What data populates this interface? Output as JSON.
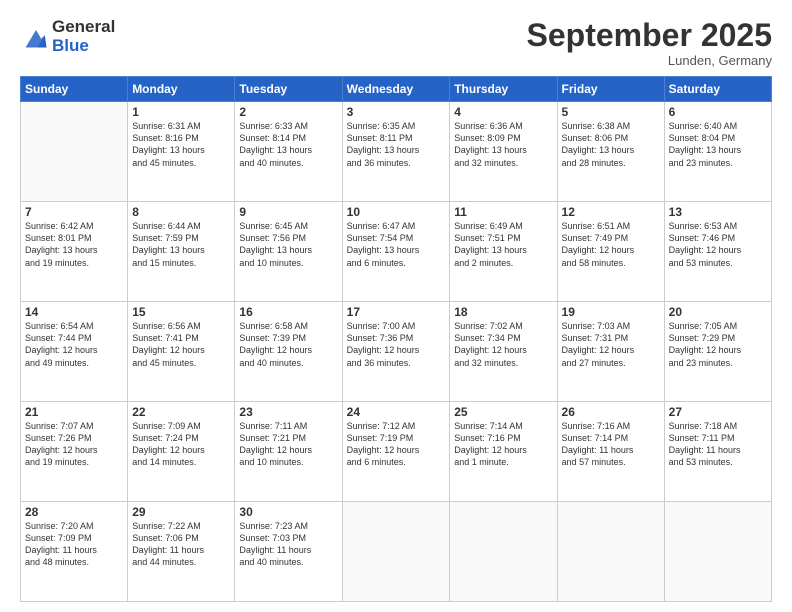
{
  "logo": {
    "general": "General",
    "blue": "Blue"
  },
  "title": "September 2025",
  "subtitle": "Lunden, Germany",
  "days_of_week": [
    "Sunday",
    "Monday",
    "Tuesday",
    "Wednesday",
    "Thursday",
    "Friday",
    "Saturday"
  ],
  "weeks": [
    [
      {
        "day": "",
        "info": ""
      },
      {
        "day": "1",
        "info": "Sunrise: 6:31 AM\nSunset: 8:16 PM\nDaylight: 13 hours\nand 45 minutes."
      },
      {
        "day": "2",
        "info": "Sunrise: 6:33 AM\nSunset: 8:14 PM\nDaylight: 13 hours\nand 40 minutes."
      },
      {
        "day": "3",
        "info": "Sunrise: 6:35 AM\nSunset: 8:11 PM\nDaylight: 13 hours\nand 36 minutes."
      },
      {
        "day": "4",
        "info": "Sunrise: 6:36 AM\nSunset: 8:09 PM\nDaylight: 13 hours\nand 32 minutes."
      },
      {
        "day": "5",
        "info": "Sunrise: 6:38 AM\nSunset: 8:06 PM\nDaylight: 13 hours\nand 28 minutes."
      },
      {
        "day": "6",
        "info": "Sunrise: 6:40 AM\nSunset: 8:04 PM\nDaylight: 13 hours\nand 23 minutes."
      }
    ],
    [
      {
        "day": "7",
        "info": "Sunrise: 6:42 AM\nSunset: 8:01 PM\nDaylight: 13 hours\nand 19 minutes."
      },
      {
        "day": "8",
        "info": "Sunrise: 6:44 AM\nSunset: 7:59 PM\nDaylight: 13 hours\nand 15 minutes."
      },
      {
        "day": "9",
        "info": "Sunrise: 6:45 AM\nSunset: 7:56 PM\nDaylight: 13 hours\nand 10 minutes."
      },
      {
        "day": "10",
        "info": "Sunrise: 6:47 AM\nSunset: 7:54 PM\nDaylight: 13 hours\nand 6 minutes."
      },
      {
        "day": "11",
        "info": "Sunrise: 6:49 AM\nSunset: 7:51 PM\nDaylight: 13 hours\nand 2 minutes."
      },
      {
        "day": "12",
        "info": "Sunrise: 6:51 AM\nSunset: 7:49 PM\nDaylight: 12 hours\nand 58 minutes."
      },
      {
        "day": "13",
        "info": "Sunrise: 6:53 AM\nSunset: 7:46 PM\nDaylight: 12 hours\nand 53 minutes."
      }
    ],
    [
      {
        "day": "14",
        "info": "Sunrise: 6:54 AM\nSunset: 7:44 PM\nDaylight: 12 hours\nand 49 minutes."
      },
      {
        "day": "15",
        "info": "Sunrise: 6:56 AM\nSunset: 7:41 PM\nDaylight: 12 hours\nand 45 minutes."
      },
      {
        "day": "16",
        "info": "Sunrise: 6:58 AM\nSunset: 7:39 PM\nDaylight: 12 hours\nand 40 minutes."
      },
      {
        "day": "17",
        "info": "Sunrise: 7:00 AM\nSunset: 7:36 PM\nDaylight: 12 hours\nand 36 minutes."
      },
      {
        "day": "18",
        "info": "Sunrise: 7:02 AM\nSunset: 7:34 PM\nDaylight: 12 hours\nand 32 minutes."
      },
      {
        "day": "19",
        "info": "Sunrise: 7:03 AM\nSunset: 7:31 PM\nDaylight: 12 hours\nand 27 minutes."
      },
      {
        "day": "20",
        "info": "Sunrise: 7:05 AM\nSunset: 7:29 PM\nDaylight: 12 hours\nand 23 minutes."
      }
    ],
    [
      {
        "day": "21",
        "info": "Sunrise: 7:07 AM\nSunset: 7:26 PM\nDaylight: 12 hours\nand 19 minutes."
      },
      {
        "day": "22",
        "info": "Sunrise: 7:09 AM\nSunset: 7:24 PM\nDaylight: 12 hours\nand 14 minutes."
      },
      {
        "day": "23",
        "info": "Sunrise: 7:11 AM\nSunset: 7:21 PM\nDaylight: 12 hours\nand 10 minutes."
      },
      {
        "day": "24",
        "info": "Sunrise: 7:12 AM\nSunset: 7:19 PM\nDaylight: 12 hours\nand 6 minutes."
      },
      {
        "day": "25",
        "info": "Sunrise: 7:14 AM\nSunset: 7:16 PM\nDaylight: 12 hours\nand 1 minute."
      },
      {
        "day": "26",
        "info": "Sunrise: 7:16 AM\nSunset: 7:14 PM\nDaylight: 11 hours\nand 57 minutes."
      },
      {
        "day": "27",
        "info": "Sunrise: 7:18 AM\nSunset: 7:11 PM\nDaylight: 11 hours\nand 53 minutes."
      }
    ],
    [
      {
        "day": "28",
        "info": "Sunrise: 7:20 AM\nSunset: 7:09 PM\nDaylight: 11 hours\nand 48 minutes."
      },
      {
        "day": "29",
        "info": "Sunrise: 7:22 AM\nSunset: 7:06 PM\nDaylight: 11 hours\nand 44 minutes."
      },
      {
        "day": "30",
        "info": "Sunrise: 7:23 AM\nSunset: 7:03 PM\nDaylight: 11 hours\nand 40 minutes."
      },
      {
        "day": "",
        "info": ""
      },
      {
        "day": "",
        "info": ""
      },
      {
        "day": "",
        "info": ""
      },
      {
        "day": "",
        "info": ""
      }
    ]
  ]
}
